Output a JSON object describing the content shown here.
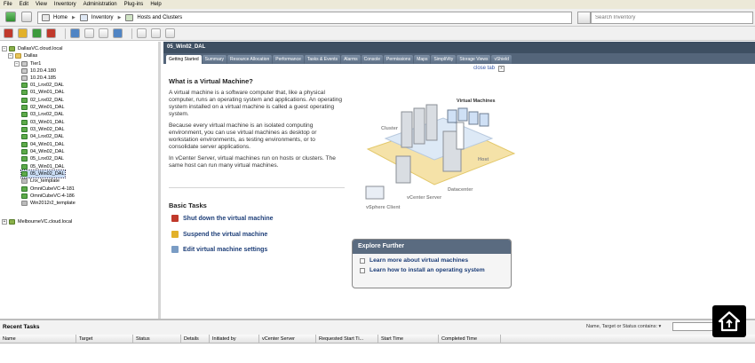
{
  "menu": [
    "File",
    "Edit",
    "View",
    "Inventory",
    "Administration",
    "Plug-ins",
    "Help"
  ],
  "breadcrumb": {
    "home": "Home",
    "inventory": "Inventory",
    "hosts": "Hosts and Clusters"
  },
  "search": {
    "placeholder": "Search Inventory"
  },
  "tree": [
    {
      "label": "DallasVC.cloud.local",
      "icon": "vcenter"
    },
    {
      "label": "Dallas",
      "icon": "datacenter"
    },
    {
      "label": "Tier1",
      "icon": "cluster"
    },
    {
      "label": "10.20.4.180",
      "icon": "host"
    },
    {
      "label": "10.20.4.185",
      "icon": "host"
    },
    {
      "label": "01_Lnx02_DAL",
      "icon": "vm"
    },
    {
      "label": "01_Win01_DAL",
      "icon": "vm"
    },
    {
      "label": "02_Lnx02_DAL",
      "icon": "vm"
    },
    {
      "label": "02_Win01_DAL",
      "icon": "vm"
    },
    {
      "label": "03_Lnx02_DAL",
      "icon": "vm"
    },
    {
      "label": "03_Win01_DAL",
      "icon": "vm"
    },
    {
      "label": "03_Win02_DAL",
      "icon": "vm"
    },
    {
      "label": "04_Lnx02_DAL",
      "icon": "vm"
    },
    {
      "label": "04_Win01_DAL",
      "icon": "vm"
    },
    {
      "label": "04_Win02_DAL",
      "icon": "vm"
    },
    {
      "label": "05_Lnx02_DAL",
      "icon": "vm"
    },
    {
      "label": "05_Win01_DAL",
      "icon": "vm"
    },
    {
      "label": "05_Win02_DAL",
      "icon": "vm"
    },
    {
      "label": "Lnx_template",
      "icon": "template"
    },
    {
      "label": "OmniCubeVC-4-181",
      "icon": "vm"
    },
    {
      "label": "OmniCubeVC-4-186",
      "icon": "vm"
    },
    {
      "label": "Win2012r2_template",
      "icon": "template"
    },
    {
      "label": "MelbourneVC.cloud.local",
      "icon": "vcenter"
    }
  ],
  "vm_title": "05_Win02_DAL",
  "tabs": [
    "Getting Started",
    "Summary",
    "Resource Allocation",
    "Performance",
    "Tasks & Events",
    "Alarms",
    "Console",
    "Permissions",
    "Maps",
    "SimpliVity",
    "Storage Views",
    "vShield"
  ],
  "close_tab": "close tab",
  "intro": {
    "heading": "What is a Virtual Machine?",
    "p1": "A virtual machine is a software computer that, like a physical computer, runs an operating system and applications. An operating system installed on a virtual machine is called a guest operating system.",
    "p2": "Because every virtual machine is an isolated computing environment, you can use virtual machines as desktop or workstation environments, as testing environments, or to consolidate server applications.",
    "p3": "In vCenter Server, virtual machines run on hosts or clusters. The same host can run many virtual machines."
  },
  "diagram": {
    "cluster": "Cluster",
    "vms": "Virtual Machines",
    "host": "Host",
    "datacenter": "Datacenter",
    "vcenter": "vCenter Server",
    "client": "vSphere Client"
  },
  "basic_tasks": {
    "heading": "Basic Tasks",
    "items": [
      "Shut down the virtual machine",
      "Suspend the virtual machine",
      "Edit virtual machine settings"
    ]
  },
  "explore": {
    "heading": "Explore Further",
    "links": [
      "Learn more about virtual machines",
      "Learn how to install an operating system"
    ]
  },
  "recent": {
    "title": "Recent Tasks",
    "filter_label": "Name, Target or Status contains: ▾",
    "columns": [
      "Name",
      "Target",
      "Status",
      "Details",
      "Initiated by",
      "vCenter Server",
      "Requested Start Ti...",
      "Start Time",
      "Completed Time"
    ]
  }
}
